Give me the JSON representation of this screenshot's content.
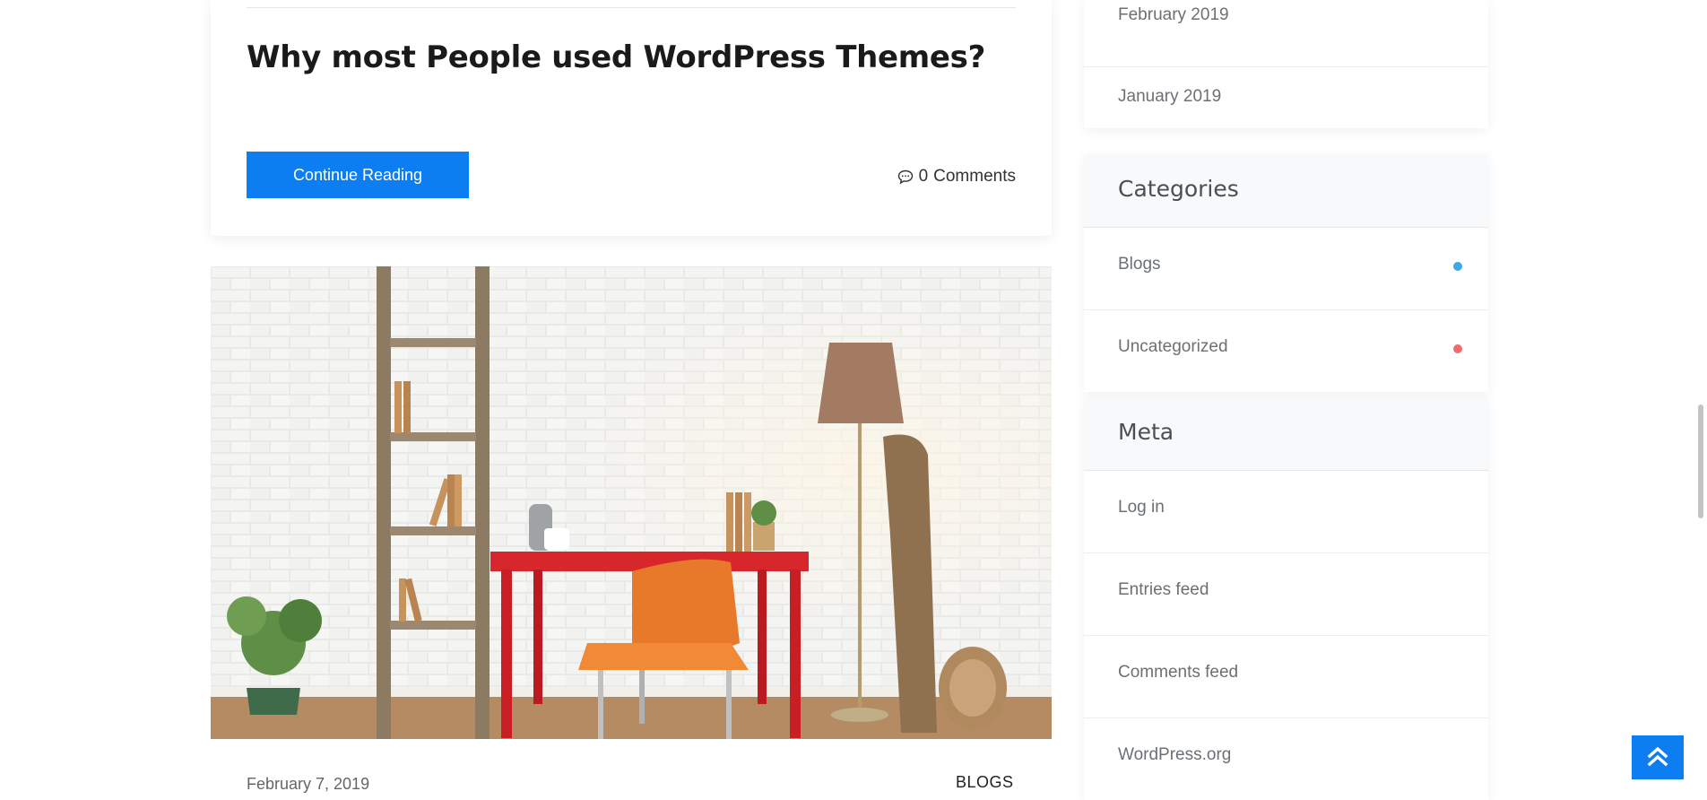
{
  "post": {
    "title": "Why most People used WordPress Themes?",
    "continue_label": "Continue Reading",
    "comments_count": "0",
    "comments_label": "Comments"
  },
  "next_post": {
    "image_icon": "photo-desk-lamp-brick-wall",
    "date": "February 7, 2019",
    "category": "BLOGS"
  },
  "sidebar": {
    "archives": [
      {
        "label": "February 2019"
      },
      {
        "label": "January 2019"
      }
    ],
    "categories": {
      "title": "Categories",
      "items": [
        {
          "label": "Blogs",
          "dot_color": "#3aa9e6"
        },
        {
          "label": "Uncategorized",
          "dot_color": "#f06b6b"
        }
      ]
    },
    "meta": {
      "title": "Meta",
      "items": [
        {
          "label": "Log in"
        },
        {
          "label": "Entries feed"
        },
        {
          "label": "Comments feed"
        },
        {
          "label": "WordPress.org"
        }
      ]
    }
  },
  "controls": {
    "back_to_top_icon": "double-chevron-up-icon"
  },
  "colors": {
    "accent": "#0d7df2",
    "widget_head_bg": "#f8f9fa"
  }
}
